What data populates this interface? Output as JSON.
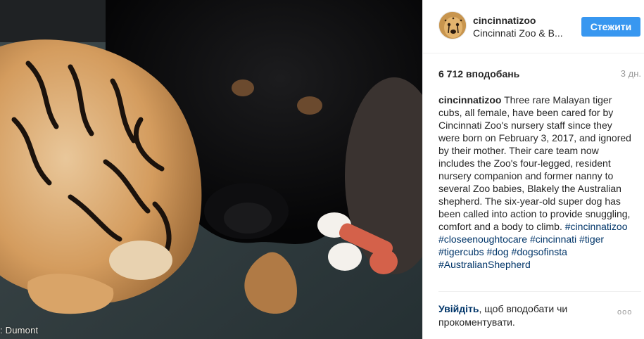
{
  "photo": {
    "credit": ": Dumont"
  },
  "header": {
    "username": "cincinnatizoo",
    "full_name": "Cincinnati Zoo & B...",
    "follow_label": "Стежити"
  },
  "stats": {
    "likes": "6 712 вподобань",
    "time_ago": "3 дн."
  },
  "caption": {
    "username": "cincinnatizoo",
    "text": "Three rare Malayan tiger cubs, all female, have been cared for by Cincinnati Zoo's nursery staff since they were born on February 3, 2017, and ignored by their mother. Their care team now includes the Zoo's four-legged, resident nursery companion and former nanny to several Zoo babies, Blakely the Australian shepherd. The six-year-old super dog has been called into action to provide snuggling, comfort and a body to climb.",
    "hashtags": [
      "#cincinnatizoo",
      "#closeenoughtocare",
      "#cincinnati",
      "#tiger",
      "#tigercubs",
      "#dog",
      "#dogsofinsta",
      "#AustralianShepherd"
    ]
  },
  "footer": {
    "login_link": "Увійдіть",
    "login_text": ", щоб вподобати чи прокоментувати.",
    "more_label": "ooo"
  },
  "icons": {
    "more": "more-options-icon"
  }
}
